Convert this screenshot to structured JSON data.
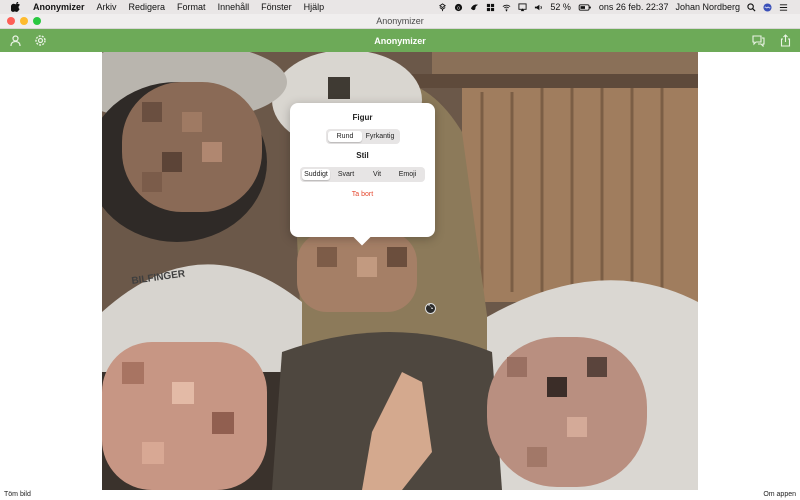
{
  "menubar": {
    "app_name": "Anonymizer",
    "items": [
      "Arkiv",
      "Redigera",
      "Format",
      "Innehåll",
      "Fönster",
      "Hjälp"
    ],
    "battery": "52 %",
    "datetime": "ons 26 feb.  22:37",
    "user": "Johan Nordberg"
  },
  "window": {
    "title": "Anonymizer"
  },
  "toolbar": {
    "title": "Anonymizer"
  },
  "popover": {
    "shape_heading": "Figur",
    "shape_options": [
      "Rund",
      "Fyrkantig"
    ],
    "shape_selected": "Rund",
    "style_heading": "Stil",
    "style_options": [
      "Suddigt",
      "Svart",
      "Vit",
      "Emoji"
    ],
    "style_selected": "Suddigt",
    "remove_label": "Ta bort"
  },
  "photo": {
    "helmet_text": "BILFINGER"
  },
  "footer": {
    "clear_label": "Töm bild",
    "about_label": "Om appen"
  },
  "colors": {
    "toolbar_green": "#6daa58",
    "remove_red": "#e5472e"
  }
}
